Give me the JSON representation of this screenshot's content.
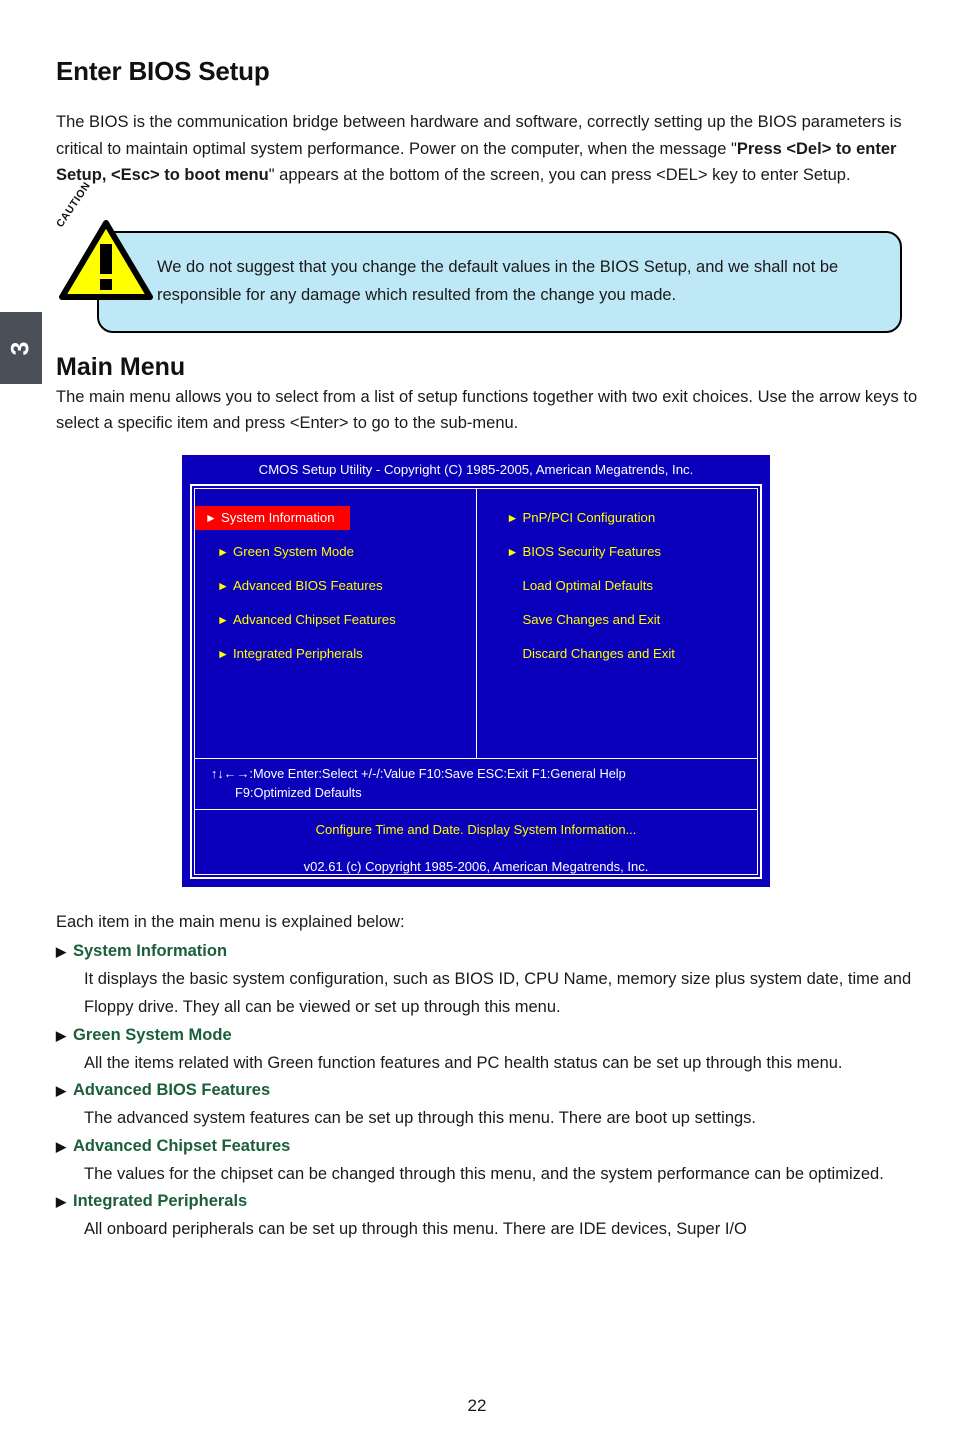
{
  "chapter_tab": {
    "number": "3"
  },
  "heading": "Enter BIOS Setup",
  "intro": {
    "part1": "The BIOS is the communication bridge between hardware and software, correctly setting up the BIOS parameters is critical to maintain optimal system performance. Power on the computer, when the message \"",
    "bold": "Press <Del> to enter Setup, <Esc> to boot menu",
    "part2": "\" appears at the bottom of the screen, you can press <DEL> key to enter Setup."
  },
  "caution": {
    "label": "CAUTION",
    "mark": "!",
    "text": "We do not suggest that you change the default values in the BIOS Setup, and we shall not be responsible for any damage which resulted from the change you made.",
    "box_color": "#bfe8f7",
    "triangle_color": "#ffff00"
  },
  "main_menu": {
    "heading": "Main Menu",
    "description": "The main menu allows you to select from a list of setup functions together with two exit choices. Use the arrow keys to select a specific item and press <Enter> to go to the sub-menu."
  },
  "bios": {
    "title": "CMOS Setup Utility - Copyright (C) 1985-2005, American Megatrends, Inc.",
    "background_color": "#0a00bb",
    "item_color": "#ffff00",
    "highlight_color": "#ff0000",
    "left_column": [
      {
        "label": "System Information",
        "arrow": "►",
        "selected": true
      },
      {
        "label": "Green System Mode",
        "arrow": "►",
        "selected": false
      },
      {
        "label": "Advanced BIOS Features",
        "arrow": "►",
        "selected": false
      },
      {
        "label": "Advanced Chipset Features",
        "arrow": "►",
        "selected": false
      },
      {
        "label": "Integrated Peripherals",
        "arrow": "►",
        "selected": false
      }
    ],
    "right_column": [
      {
        "label": "PnP/PCI Configuration",
        "arrow": "►",
        "selected": false
      },
      {
        "label": "BIOS Security Features",
        "arrow": "►",
        "selected": false
      },
      {
        "label": "Load Optimal Defaults",
        "arrow": "",
        "selected": false
      },
      {
        "label": "Save Changes and Exit",
        "arrow": "",
        "selected": false
      },
      {
        "label": "Discard Changes and Exit",
        "arrow": "",
        "selected": false
      }
    ],
    "keys_line1": "↑↓←→:Move  Enter:Select    +/-/:Value     F10:Save   ESC:Exit     F1:General Help",
    "keys_line2": "F9:Optimized Defaults",
    "help_text": "Configure Time and Date.  Display System Information...",
    "version": "v02.61   (c) Copyright 1985-2006, American Megatrends, Inc."
  },
  "explanations": {
    "lead": "Each item in the main menu is explained below:",
    "bullet": "▶",
    "items": [
      {
        "title": "System Information",
        "desc": "It displays the basic system configuration, such as BIOS ID, CPU Name, memory size plus system date, time and Floppy drive. They all can be viewed or set up through this menu."
      },
      {
        "title": "Green System Mode",
        "desc": "All the items related with Green function features and PC health status can be set up through this menu."
      },
      {
        "title": "Advanced BIOS Features",
        "desc": "The advanced system features can be set up through this menu. There are boot up settings."
      },
      {
        "title": "Advanced Chipset Features",
        "desc": "The values for the chipset can be changed through this menu, and the system performance can be optimized."
      },
      {
        "title": "Integrated Peripherals",
        "desc": "All onboard peripherals can be set up through this menu. There are IDE devices, Super I/O"
      }
    ]
  },
  "page_number": "22"
}
